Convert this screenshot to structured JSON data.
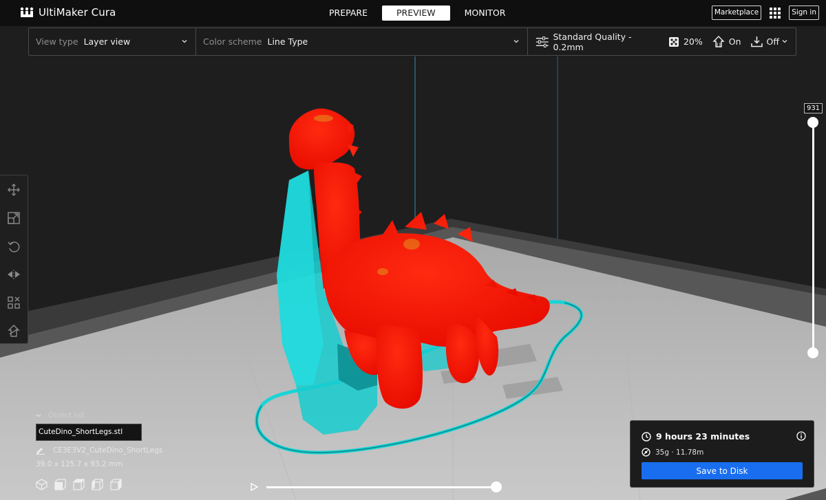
{
  "app": {
    "title": "UltiMaker Cura"
  },
  "stages": [
    {
      "label": "PREPARE",
      "active": false
    },
    {
      "label": "PREVIEW",
      "active": true
    },
    {
      "label": "MONITOR",
      "active": false
    }
  ],
  "topbar": {
    "marketplace_label": "Marketplace",
    "signin_label": "Sign in",
    "apps_icon": "apps-grid-icon"
  },
  "view_settings": {
    "view_type_label": "View type",
    "view_type_value": "Layer view",
    "color_scheme_label": "Color scheme",
    "color_scheme_value": "Line Type"
  },
  "print_settings": {
    "profile": "Standard Quality - 0.2mm",
    "infill": "20%",
    "support": "On",
    "adhesion": "Off"
  },
  "left_tools": [
    "move-icon",
    "scale-icon",
    "rotate-icon",
    "mirror-icon",
    "per-model-settings-icon",
    "support-blocker-icon"
  ],
  "layer_slider": {
    "current_layer": "931",
    "top_fraction": 1.0,
    "bottom_fraction": 0.0
  },
  "object_list": {
    "header": "Object list",
    "selected_file": "CuteDino_ShortLegs.stl",
    "job_name": "CE3E3V2_CuteDino_ShortLegs",
    "dimensions": "39.0 x 125.7 x 93.2 mm",
    "camera_views": [
      "3d-view-icon",
      "front-view-icon",
      "top-view-icon",
      "left-view-icon",
      "right-view-icon"
    ]
  },
  "playback": {
    "progress": 1.0
  },
  "print_info": {
    "time": "9 hours 23 minutes",
    "material": "35g · 11.78m",
    "save_label": "Save to Disk"
  },
  "colors": {
    "model": "#ff1a00",
    "support": "#19d4d6",
    "accent": "#196ef0",
    "build_plate": "#c4c4c4"
  }
}
